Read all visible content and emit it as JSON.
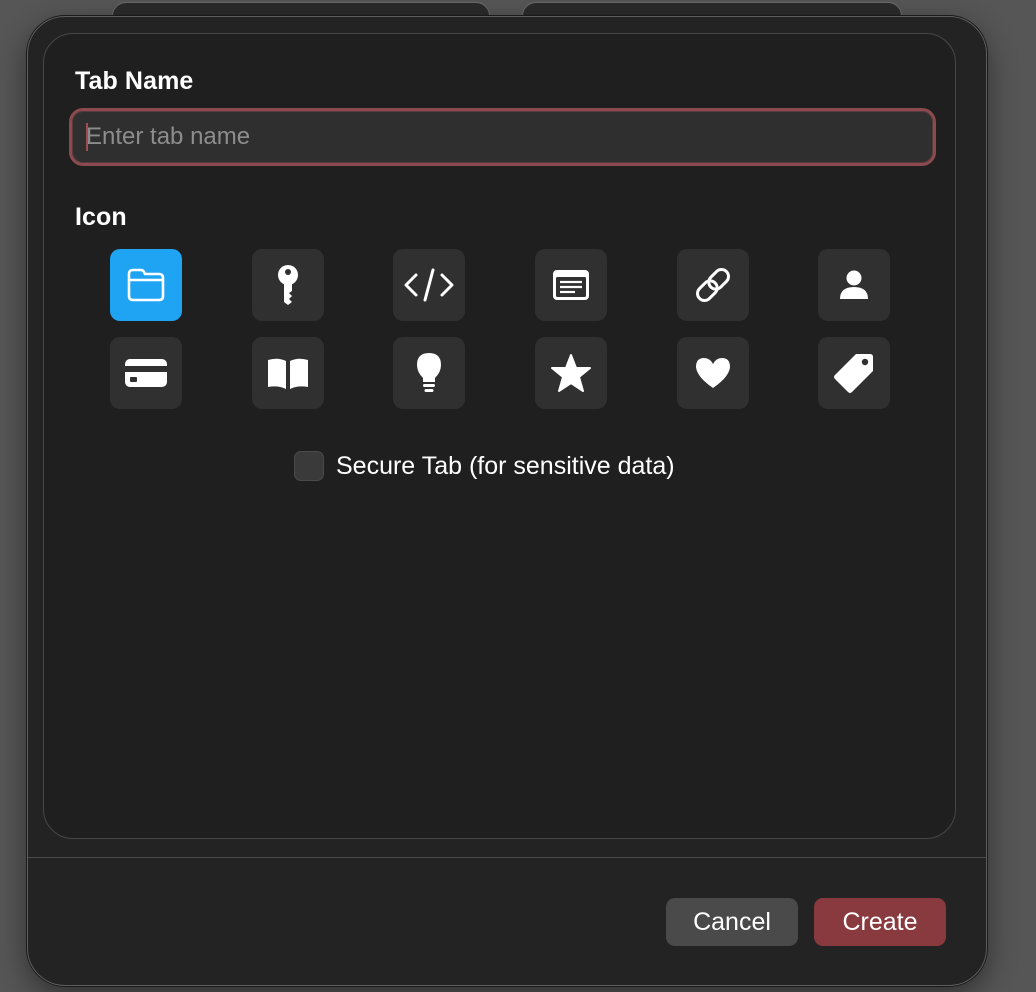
{
  "dialog": {
    "tab_name_label": "Tab Name",
    "tab_name_input": {
      "value": "",
      "placeholder": "Enter tab name"
    },
    "icon_label": "Icon",
    "icons": [
      {
        "name": "folder-icon",
        "selected": true
      },
      {
        "name": "key-icon",
        "selected": false
      },
      {
        "name": "code-icon",
        "selected": false
      },
      {
        "name": "document-icon",
        "selected": false
      },
      {
        "name": "link-icon",
        "selected": false
      },
      {
        "name": "person-icon",
        "selected": false
      },
      {
        "name": "credit-card-icon",
        "selected": false
      },
      {
        "name": "book-icon",
        "selected": false
      },
      {
        "name": "lightbulb-icon",
        "selected": false
      },
      {
        "name": "star-icon",
        "selected": false
      },
      {
        "name": "heart-icon",
        "selected": false
      },
      {
        "name": "tag-icon",
        "selected": false
      }
    ],
    "secure_tab": {
      "label": "Secure Tab (for sensitive data)",
      "checked": false
    },
    "buttons": {
      "cancel": "Cancel",
      "create": "Create"
    }
  },
  "colors": {
    "accent_selected": "#1ea4f3",
    "primary_button": "#883a3f",
    "input_focus_border": "#8a4a4e",
    "background": "#232323"
  }
}
